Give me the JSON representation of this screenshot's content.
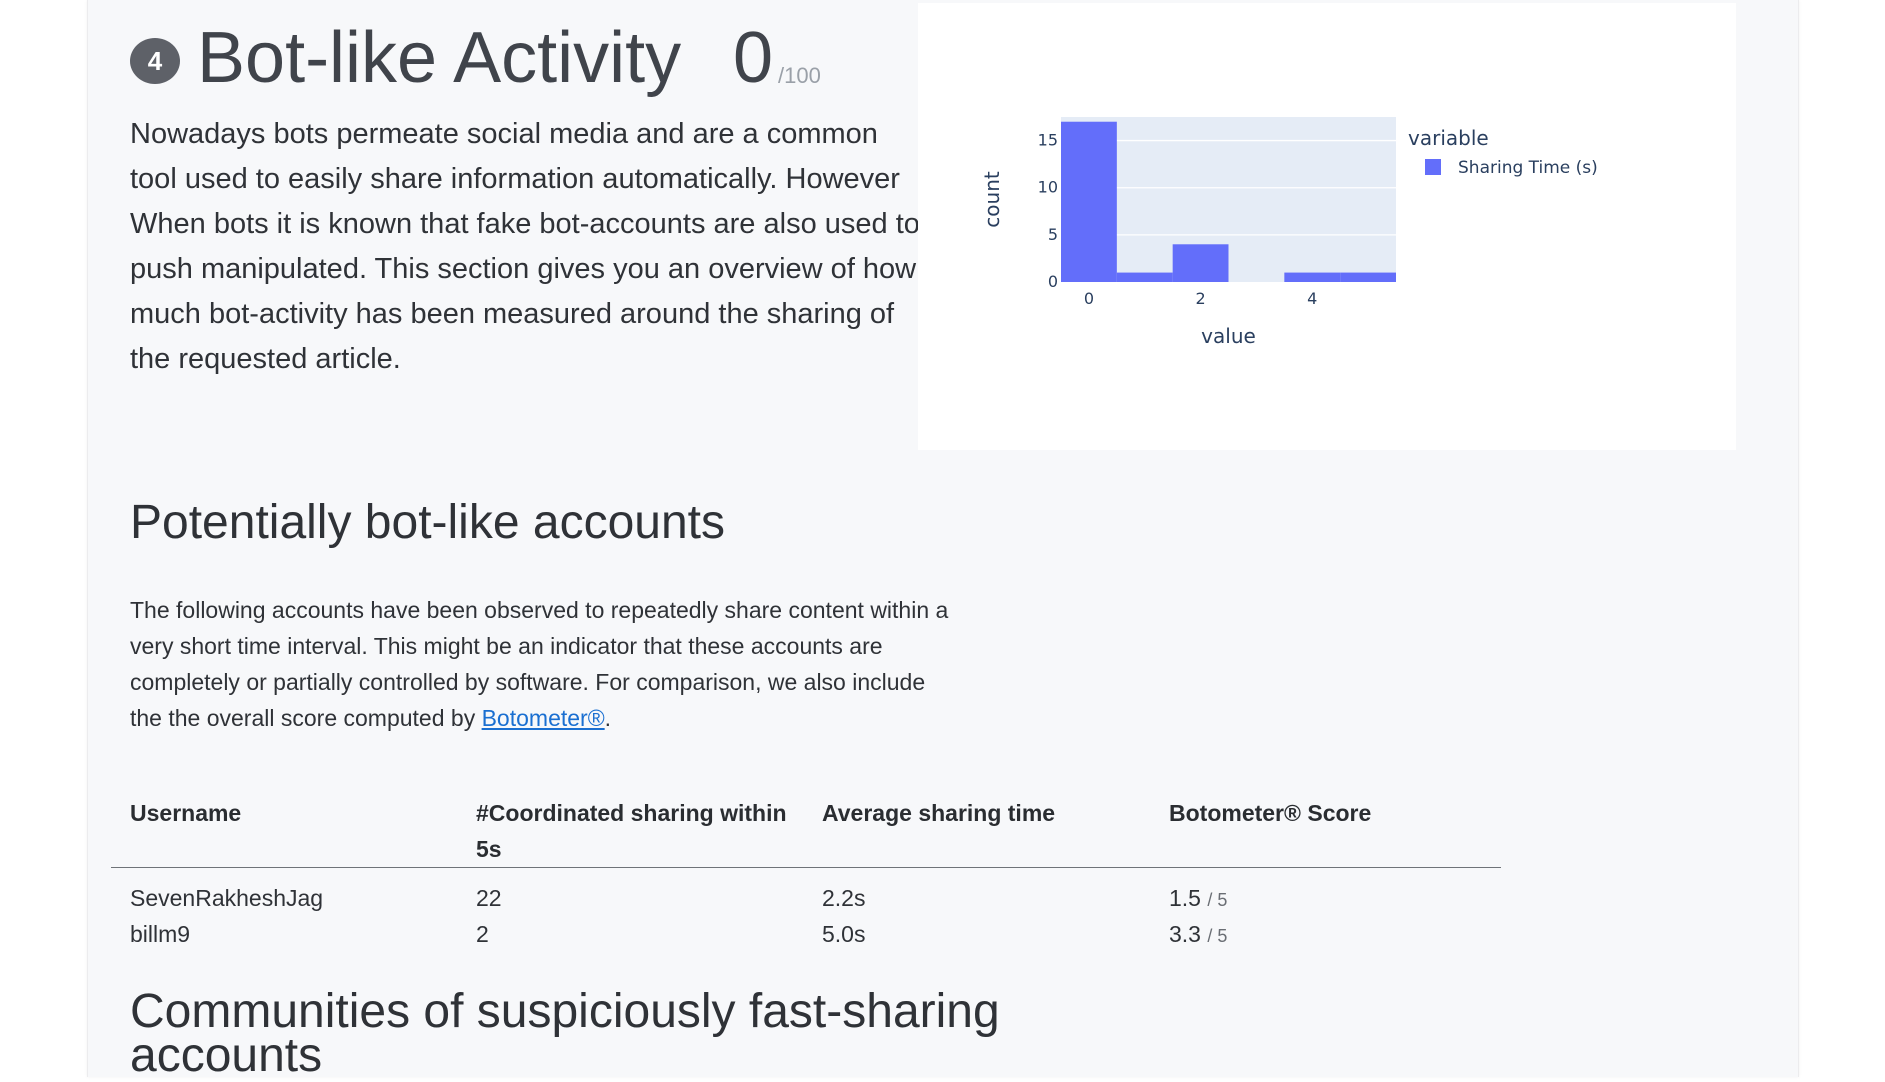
{
  "header": {
    "step_number": "4",
    "title": "Bot-like Activity",
    "score": "0",
    "score_max": "/100"
  },
  "intro_text": "Nowadays bots permeate social media and are a common tool used to easily share information automatically. However When bots it is known that fake bot-accounts are also used to push manipulated. This section gives you an overview of how much bot-activity has been measured around the sharing of the requested article.",
  "chart_data": {
    "type": "bar",
    "xlabel": "value",
    "ylabel": "count",
    "legend_title": "variable",
    "legend_placement": "right",
    "bar_color": "#636efa",
    "plot_bg": "#e5ecf6",
    "x_ticks": [
      "0",
      "2",
      "4"
    ],
    "y_ticks": [
      "0",
      "5",
      "10",
      "15"
    ],
    "xlim": [
      -0.5,
      5.5
    ],
    "ylim": [
      0,
      17.5
    ],
    "bins": [
      {
        "x0": -0.5,
        "x1": 0.5,
        "count": 17
      },
      {
        "x0": 0.5,
        "x1": 1.5,
        "count": 1
      },
      {
        "x0": 1.5,
        "x1": 2.5,
        "count": 4
      },
      {
        "x0": 2.5,
        "x1": 3.5,
        "count": 0
      },
      {
        "x0": 3.5,
        "x1": 4.5,
        "count": 1
      },
      {
        "x0": 4.5,
        "x1": 5.5,
        "count": 1
      }
    ],
    "series": [
      {
        "name": "Sharing Time (s)"
      }
    ]
  },
  "accounts_section": {
    "title": "Potentially bot-like accounts",
    "desc_before_link": "The following accounts have been observed to repeatedly share content within a very short time interval. This might be an indicator that these accounts are completely or partially controlled by software. For comparison, we also include the the overall score computed by ",
    "link_text": "Botometer®",
    "desc_after_link": "."
  },
  "table": {
    "columns": [
      "Username",
      "#Coordinated sharing within 5s",
      "Average sharing time",
      "Botometer® Score"
    ],
    "rows": [
      {
        "username": "SevenRakheshJag",
        "coordinated": "22",
        "avg_time": "2.2s",
        "score": "1.5",
        "score_max": "/ 5"
      },
      {
        "username": "billm9",
        "coordinated": "2",
        "avg_time": "5.0s",
        "score": "3.3",
        "score_max": "/ 5"
      }
    ]
  },
  "next_section_title": "Communities of suspiciously fast-sharing accounts"
}
